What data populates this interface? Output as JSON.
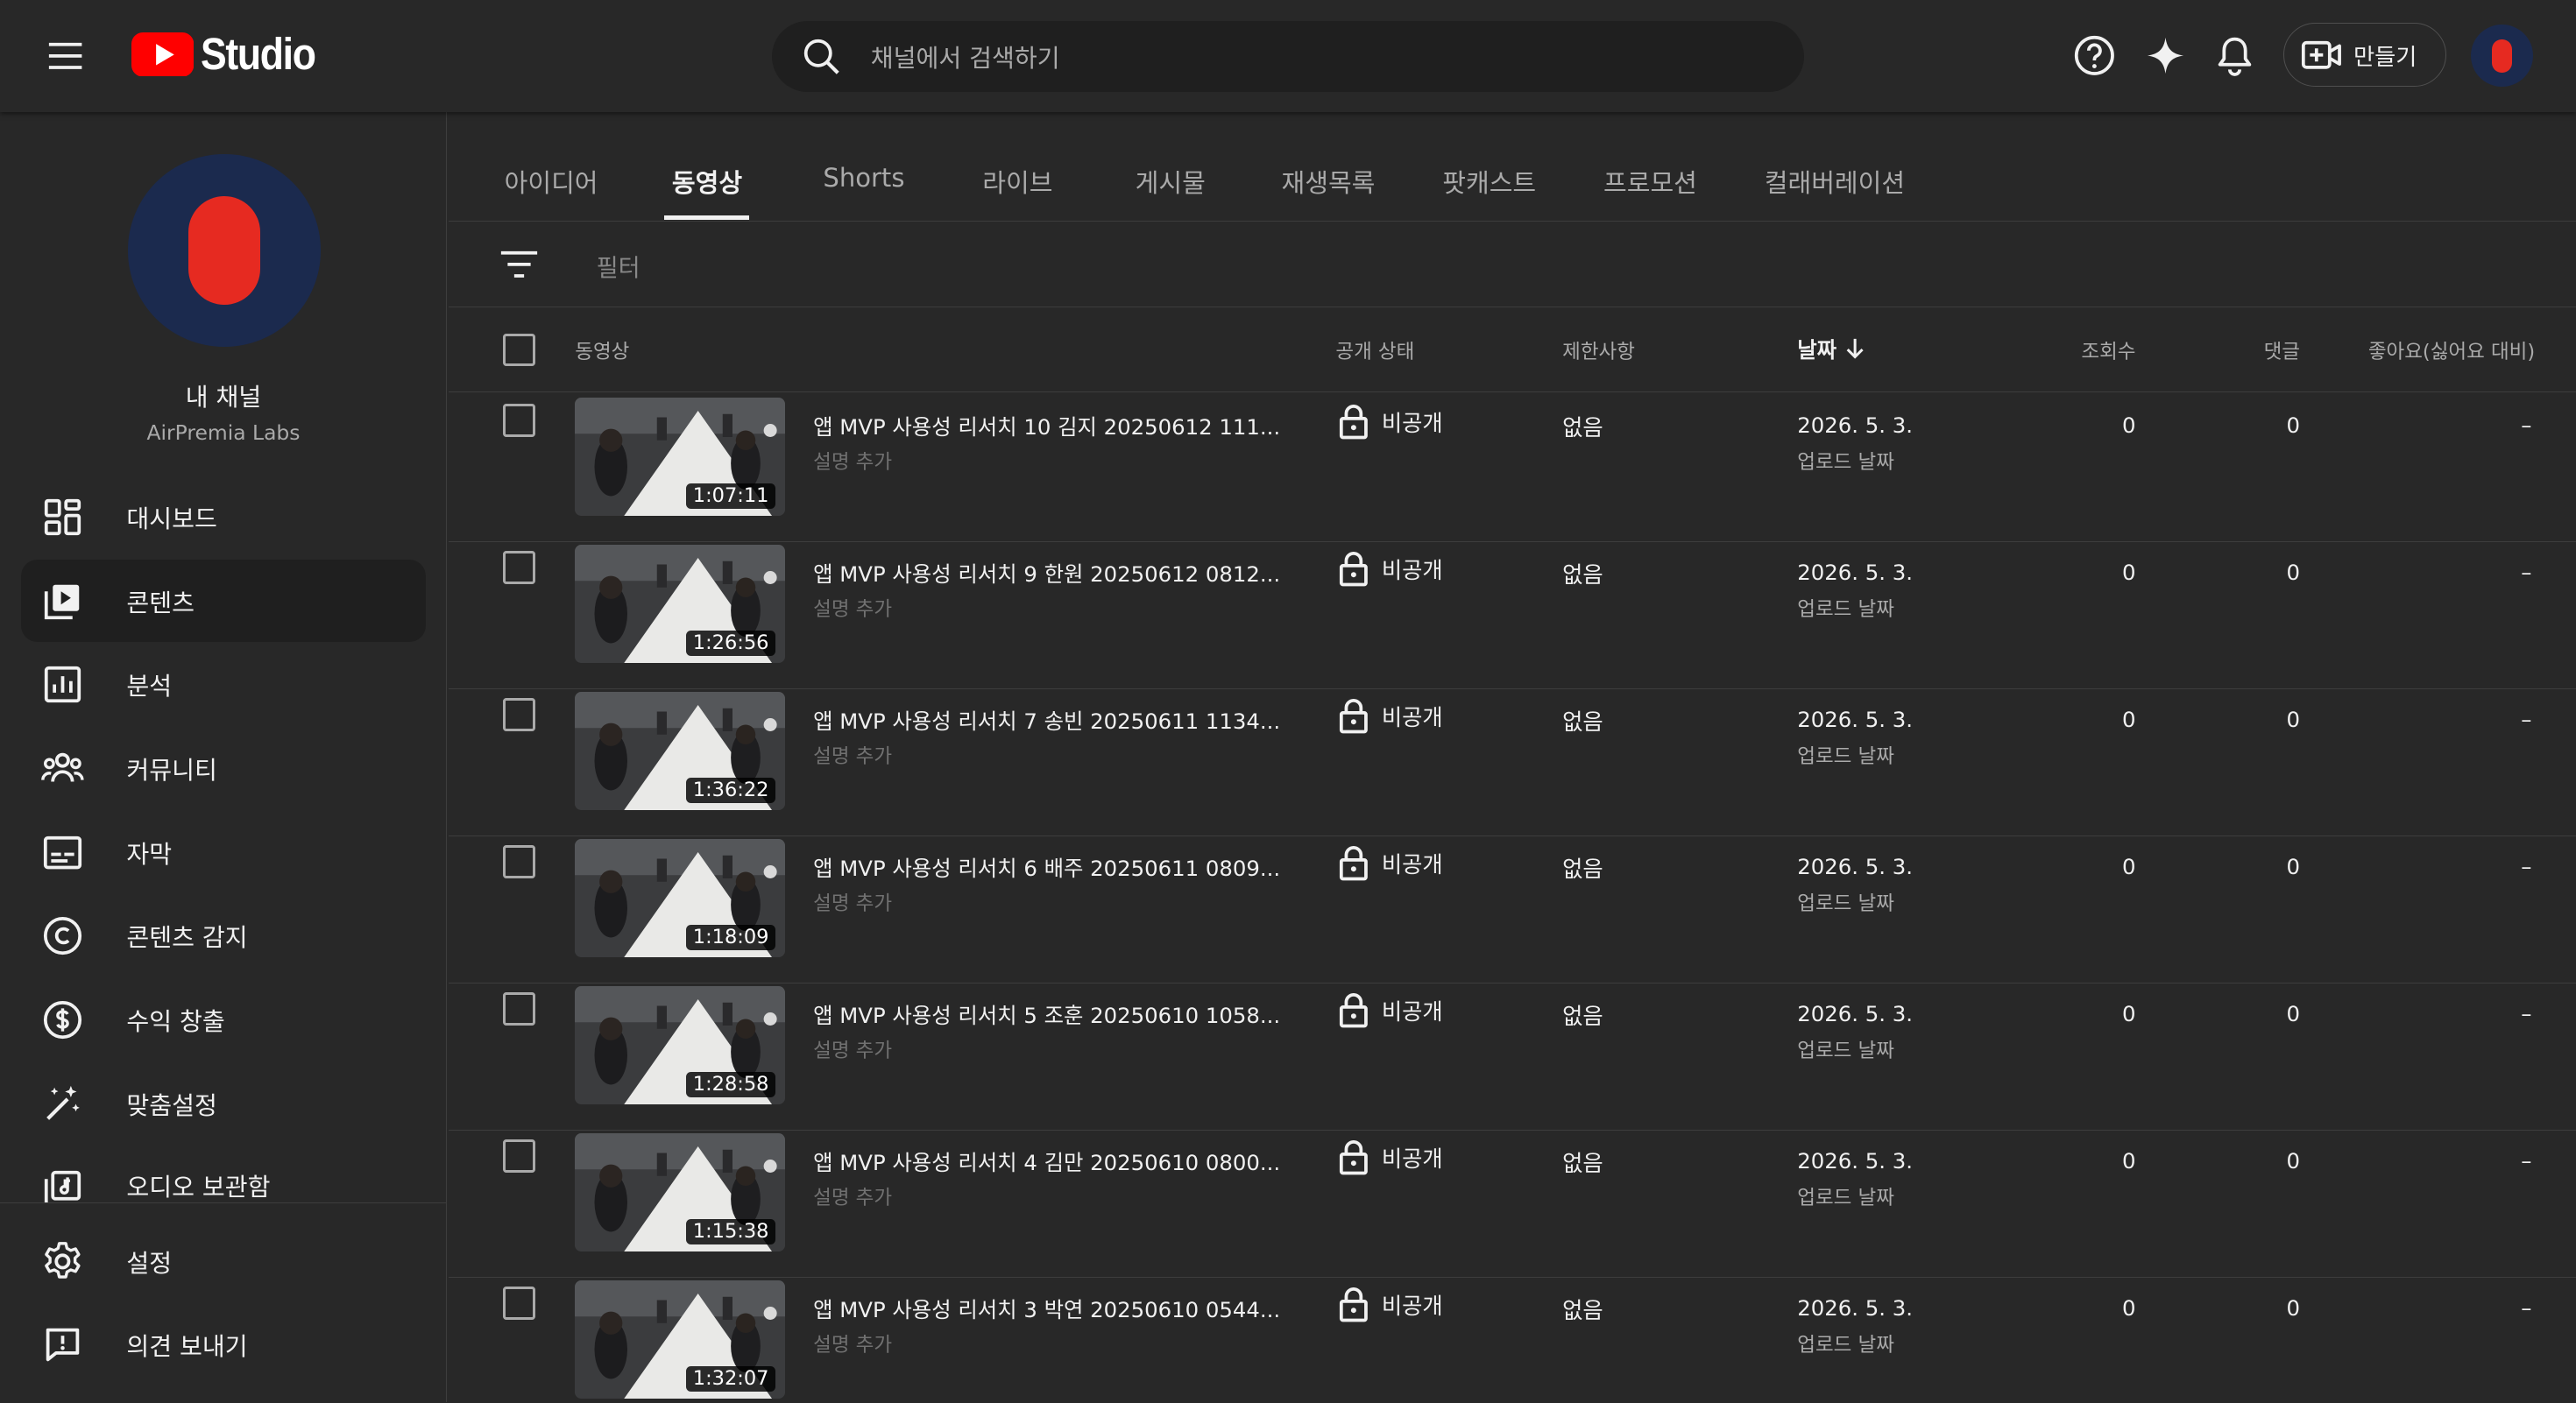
{
  "header": {
    "logo_text": "Studio",
    "search_placeholder": "채널에서 검색하기",
    "create_label": "만들기",
    "colors": {
      "brand_red": "#ff0000",
      "avatar_bg": "#1b2a4e",
      "avatar_fg": "#e62a21"
    }
  },
  "sidebar": {
    "channel_title": "내 채널",
    "channel_name": "AirPremia Labs",
    "items": [
      {
        "label": "대시보드",
        "icon": "dashboard-icon",
        "active": false
      },
      {
        "label": "콘텐츠",
        "icon": "content-icon",
        "active": true
      },
      {
        "label": "분석",
        "icon": "analytics-icon",
        "active": false
      },
      {
        "label": "커뮤니티",
        "icon": "community-icon",
        "active": false
      },
      {
        "label": "자막",
        "icon": "subtitles-icon",
        "active": false
      },
      {
        "label": "콘텐츠 감지",
        "icon": "copyright-icon",
        "active": false
      },
      {
        "label": "수익 창출",
        "icon": "dollar-icon",
        "active": false
      },
      {
        "label": "맞춤설정",
        "icon": "magic-wand-icon",
        "active": false
      },
      {
        "label": "오디오 보관함",
        "icon": "audio-library-icon",
        "active": false
      }
    ],
    "bottom_items": [
      {
        "label": "설정",
        "icon": "gear-icon"
      },
      {
        "label": "의견 보내기",
        "icon": "feedback-icon"
      }
    ]
  },
  "tabs": [
    {
      "label": "아이디어",
      "active": false
    },
    {
      "label": "동영상",
      "active": true
    },
    {
      "label": "Shorts",
      "active": false
    },
    {
      "label": "라이브",
      "active": false
    },
    {
      "label": "게시물",
      "active": false
    },
    {
      "label": "재생목록",
      "active": false
    },
    {
      "label": "팟캐스트",
      "active": false
    },
    {
      "label": "프로모션",
      "active": false
    },
    {
      "label": "컬래버레이션",
      "active": false
    }
  ],
  "filter": {
    "placeholder": "필터"
  },
  "table": {
    "columns": {
      "video": "동영상",
      "visibility": "공개 상태",
      "restrictions": "제한사항",
      "date": "날짜",
      "views": "조회수",
      "comments": "댓글",
      "likes": "좋아요(싫어요 대비)"
    },
    "rows": [
      {
        "title": "앱 MVP 사용성 리서치 10 김지 20250612 111...",
        "description": "설명 추가",
        "duration": "1:07:11",
        "visibility": "비공개",
        "restrictions": "없음",
        "date": "2026. 5. 3.",
        "date_sub": "업로드 날짜",
        "views": "0",
        "comments": "0",
        "likes": "–"
      },
      {
        "title": "앱 MVP 사용성 리서치 9 한원 20250612 0812...",
        "description": "설명 추가",
        "duration": "1:26:56",
        "visibility": "비공개",
        "restrictions": "없음",
        "date": "2026. 5. 3.",
        "date_sub": "업로드 날짜",
        "views": "0",
        "comments": "0",
        "likes": "–"
      },
      {
        "title": "앱 MVP 사용성 리서치 7 송빈 20250611 1134...",
        "description": "설명 추가",
        "duration": "1:36:22",
        "visibility": "비공개",
        "restrictions": "없음",
        "date": "2026. 5. 3.",
        "date_sub": "업로드 날짜",
        "views": "0",
        "comments": "0",
        "likes": "–"
      },
      {
        "title": "앱 MVP 사용성 리서치 6 배주 20250611 0809...",
        "description": "설명 추가",
        "duration": "1:18:09",
        "visibility": "비공개",
        "restrictions": "없음",
        "date": "2026. 5. 3.",
        "date_sub": "업로드 날짜",
        "views": "0",
        "comments": "0",
        "likes": "–"
      },
      {
        "title": "앱 MVP 사용성 리서치 5 조훈 20250610 1058...",
        "description": "설명 추가",
        "duration": "1:28:58",
        "visibility": "비공개",
        "restrictions": "없음",
        "date": "2026. 5. 3.",
        "date_sub": "업로드 날짜",
        "views": "0",
        "comments": "0",
        "likes": "–"
      },
      {
        "title": "앱 MVP 사용성 리서치 4 김만 20250610 0800...",
        "description": "설명 추가",
        "duration": "1:15:38",
        "visibility": "비공개",
        "restrictions": "없음",
        "date": "2026. 5. 3.",
        "date_sub": "업로드 날짜",
        "views": "0",
        "comments": "0",
        "likes": "–"
      },
      {
        "title": "앱 MVP 사용성 리서치 3 박연 20250610 0544...",
        "description": "설명 추가",
        "duration": "1:32:07",
        "visibility": "비공개",
        "restrictions": "없음",
        "date": "2026. 5. 3.",
        "date_sub": "업로드 날짜",
        "views": "0",
        "comments": "0",
        "likes": "–"
      }
    ]
  }
}
